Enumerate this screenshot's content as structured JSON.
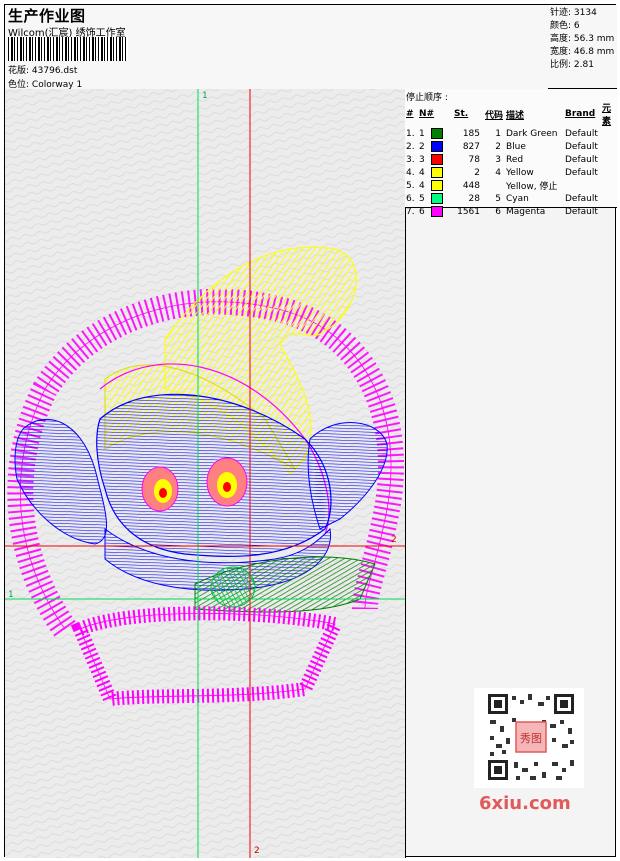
{
  "header": {
    "title": "生产作业图",
    "company": "Wilcom(汇宸) 绣饰工作室",
    "design_label": "花版:",
    "design_value": "43796.dst",
    "colorway_label": "色位:",
    "colorway_value": "Colorway 1"
  },
  "stats": {
    "stitches": "针迹: 3134",
    "colors": "颜色: 6",
    "height": "高度: 56.3 mm",
    "width": "宽度: 46.8 mm",
    "scale": "比例: 2.81"
  },
  "stop_sequence": {
    "title": "停止顺序 :",
    "columns": [
      "#",
      "N#",
      "St.",
      "代码",
      "描述",
      "Brand",
      "元素"
    ],
    "rows": [
      {
        "idx": "1.",
        "n": "1",
        "color": "#008000",
        "st": "185",
        "code": "1",
        "desc": "Dark Green",
        "brand": "Default"
      },
      {
        "idx": "2.",
        "n": "2",
        "color": "#0000ff",
        "st": "827",
        "code": "2",
        "desc": "Blue",
        "brand": "Default"
      },
      {
        "idx": "3.",
        "n": "3",
        "color": "#ff0000",
        "st": "78",
        "code": "3",
        "desc": "Red",
        "brand": "Default"
      },
      {
        "idx": "4.",
        "n": "4",
        "color": "#ffff00",
        "st": "2",
        "code": "4",
        "desc": "Yellow",
        "brand": "Default"
      },
      {
        "idx": "5.",
        "n": "4",
        "color": "#ffff00",
        "st": "448",
        "code": "",
        "desc": "Yellow, 停止",
        "brand": ""
      },
      {
        "idx": "6.",
        "n": "5",
        "color": "#00ff80",
        "st": "28",
        "code": "5",
        "desc": "Cyan",
        "brand": "Default"
      },
      {
        "idx": "7.",
        "n": "6",
        "color": "#ff00ff",
        "st": "1561",
        "code": "6",
        "desc": "Magenta",
        "brand": "Default"
      }
    ]
  },
  "axes": {
    "top_1": "1",
    "left_1": "1",
    "right_2": "2",
    "bottom_2": "2"
  },
  "watermark": "6xiu.com",
  "qr_stamp": "秀图"
}
